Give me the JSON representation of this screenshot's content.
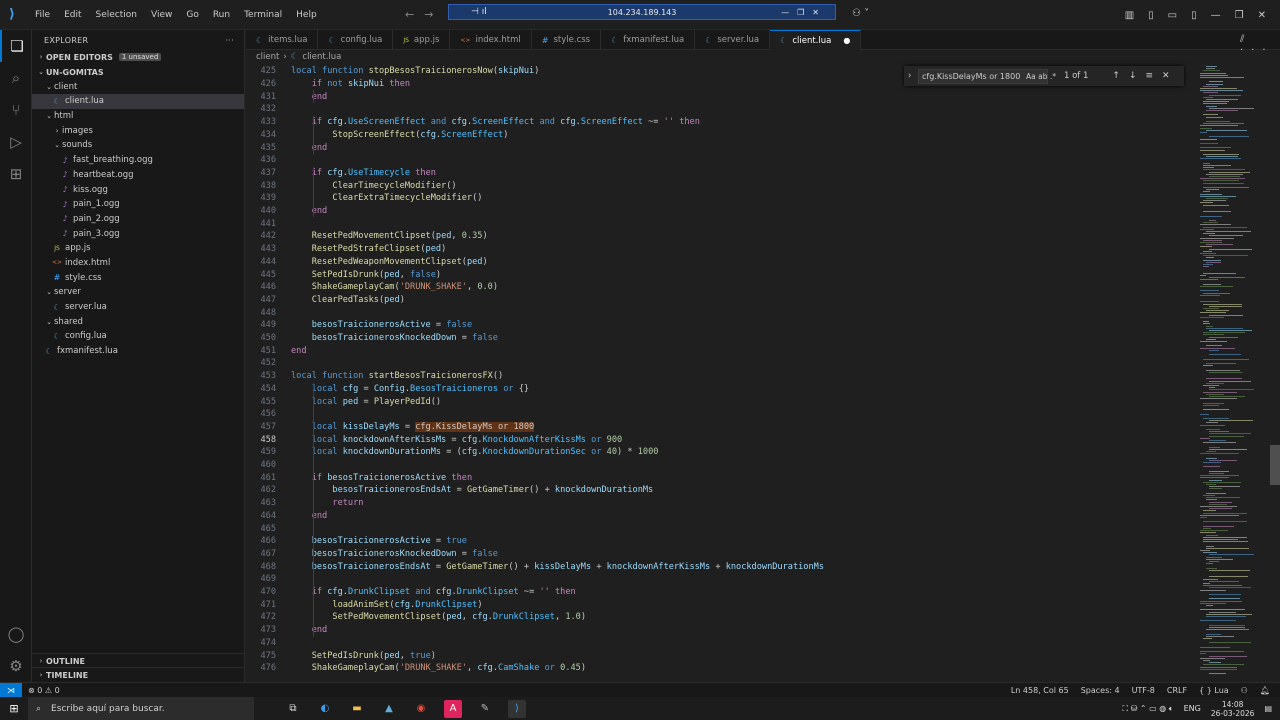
{
  "menu": [
    "File",
    "Edit",
    "Selection",
    "View",
    "Go",
    "Run",
    "Terminal",
    "Help"
  ],
  "remote_bar": {
    "address": "104.234.189.143"
  },
  "explorer": {
    "title": "EXPLORER",
    "open_editors": "OPEN EDITORS",
    "unsaved": "1 unsaved",
    "root": "UN-GOMITAS",
    "tree": [
      {
        "label": "client",
        "type": "folder",
        "depth": 1
      },
      {
        "label": "client.lua",
        "type": "lua",
        "depth": 2,
        "selected": true
      },
      {
        "label": "html",
        "type": "folder",
        "depth": 1
      },
      {
        "label": "images",
        "type": "folder-closed",
        "depth": 2
      },
      {
        "label": "sounds",
        "type": "folder",
        "depth": 2
      },
      {
        "label": "fast_breathing.ogg",
        "type": "ogg",
        "depth": 3
      },
      {
        "label": "heartbeat.ogg",
        "type": "ogg",
        "depth": 3
      },
      {
        "label": "kiss.ogg",
        "type": "ogg",
        "depth": 3
      },
      {
        "label": "pain_1.ogg",
        "type": "ogg",
        "depth": 3
      },
      {
        "label": "pain_2.ogg",
        "type": "ogg",
        "depth": 3
      },
      {
        "label": "pain_3.ogg",
        "type": "ogg",
        "depth": 3
      },
      {
        "label": "app.js",
        "type": "js",
        "depth": 2
      },
      {
        "label": "index.html",
        "type": "html",
        "depth": 2
      },
      {
        "label": "style.css",
        "type": "css",
        "depth": 2
      },
      {
        "label": "server",
        "type": "folder",
        "depth": 1
      },
      {
        "label": "server.lua",
        "type": "lua",
        "depth": 2
      },
      {
        "label": "shared",
        "type": "folder",
        "depth": 1
      },
      {
        "label": "config.lua",
        "type": "lua",
        "depth": 2
      },
      {
        "label": "fxmanifest.lua",
        "type": "lua",
        "depth": 1
      }
    ],
    "outline": "OUTLINE",
    "timeline": "TIMELINE"
  },
  "tabs": [
    {
      "label": "items.lua",
      "type": "lua"
    },
    {
      "label": "config.lua",
      "type": "lua"
    },
    {
      "label": "app.js",
      "type": "js"
    },
    {
      "label": "index.html",
      "type": "html"
    },
    {
      "label": "style.css",
      "type": "css"
    },
    {
      "label": "fxmanifest.lua",
      "type": "lua"
    },
    {
      "label": "server.lua",
      "type": "lua"
    },
    {
      "label": "client.lua",
      "type": "lua",
      "active": true
    }
  ],
  "breadcrumb": [
    "client",
    "client.lua"
  ],
  "find": {
    "query": "cfg.KissDelayMs or 1800",
    "options": "Aa  ab  .*",
    "count": "1 of 1"
  },
  "code_lines": [
    {
      "n": "425",
      "t": [
        [
          "kw",
          "local "
        ],
        [
          "kw",
          "function "
        ],
        [
          "fn",
          "stopBesosTraicionerosNow"
        ],
        [
          "code",
          "("
        ],
        [
          "vr",
          "skipNui"
        ],
        [
          "code",
          ")"
        ]
      ]
    },
    {
      "n": "426",
      "t": [
        [
          "code",
          "    "
        ],
        [
          "ctl",
          "if "
        ],
        [
          "kw",
          "not "
        ],
        [
          "vr",
          "skipNui "
        ],
        [
          "ctl",
          "then"
        ]
      ]
    },
    {
      "n": "431",
      "t": [
        [
          "code",
          "    "
        ],
        [
          "ctl",
          "end"
        ]
      ]
    },
    {
      "n": "432",
      "t": []
    },
    {
      "n": "433",
      "t": [
        [
          "code",
          "    "
        ],
        [
          "ctl",
          "if "
        ],
        [
          "vr",
          "cfg"
        ],
        [
          "code",
          "."
        ],
        [
          "prop",
          "UseScreenEffect "
        ],
        [
          "kw",
          "and "
        ],
        [
          "vr",
          "cfg"
        ],
        [
          "code",
          "."
        ],
        [
          "prop",
          "ScreenEffect "
        ],
        [
          "kw",
          "and "
        ],
        [
          "vr",
          "cfg"
        ],
        [
          "code",
          "."
        ],
        [
          "prop",
          "ScreenEffect "
        ],
        [
          "code",
          "~= "
        ],
        [
          "str",
          "'' "
        ],
        [
          "ctl",
          "then"
        ]
      ]
    },
    {
      "n": "434",
      "t": [
        [
          "code",
          "        "
        ],
        [
          "fn",
          "StopScreenEffect"
        ],
        [
          "code",
          "("
        ],
        [
          "vr",
          "cfg"
        ],
        [
          "code",
          "."
        ],
        [
          "prop",
          "ScreenEffect"
        ],
        [
          "code",
          ")"
        ]
      ]
    },
    {
      "n": "435",
      "t": [
        [
          "code",
          "    "
        ],
        [
          "ctl",
          "end"
        ]
      ]
    },
    {
      "n": "436",
      "t": []
    },
    {
      "n": "437",
      "t": [
        [
          "code",
          "    "
        ],
        [
          "ctl",
          "if "
        ],
        [
          "vr",
          "cfg"
        ],
        [
          "code",
          "."
        ],
        [
          "prop",
          "UseTimecycle "
        ],
        [
          "ctl",
          "then"
        ]
      ]
    },
    {
      "n": "438",
      "t": [
        [
          "code",
          "        "
        ],
        [
          "fn",
          "ClearTimecycleModifier"
        ],
        [
          "code",
          "()"
        ]
      ]
    },
    {
      "n": "439",
      "t": [
        [
          "code",
          "        "
        ],
        [
          "fn",
          "ClearExtraTimecycleModifier"
        ],
        [
          "code",
          "()"
        ]
      ]
    },
    {
      "n": "440",
      "t": [
        [
          "code",
          "    "
        ],
        [
          "ctl",
          "end"
        ]
      ]
    },
    {
      "n": "441",
      "t": []
    },
    {
      "n": "442",
      "t": [
        [
          "code",
          "    "
        ],
        [
          "fn",
          "ResetPedMovementClipset"
        ],
        [
          "code",
          "("
        ],
        [
          "vr",
          "ped"
        ],
        [
          "code",
          ", "
        ],
        [
          "num",
          "0.35"
        ],
        [
          "code",
          ")"
        ]
      ]
    },
    {
      "n": "443",
      "t": [
        [
          "code",
          "    "
        ],
        [
          "fn",
          "ResetPedStrafeClipset"
        ],
        [
          "code",
          "("
        ],
        [
          "vr",
          "ped"
        ],
        [
          "code",
          ")"
        ]
      ]
    },
    {
      "n": "444",
      "t": [
        [
          "code",
          "    "
        ],
        [
          "fn",
          "ResetPedWeaponMovementClipset"
        ],
        [
          "code",
          "("
        ],
        [
          "vr",
          "ped"
        ],
        [
          "code",
          ")"
        ]
      ]
    },
    {
      "n": "445",
      "t": [
        [
          "code",
          "    "
        ],
        [
          "fn",
          "SetPedIsDrunk"
        ],
        [
          "code",
          "("
        ],
        [
          "vr",
          "ped"
        ],
        [
          "code",
          ", "
        ],
        [
          "kw",
          "false"
        ],
        [
          "code",
          ")"
        ]
      ]
    },
    {
      "n": "446",
      "t": [
        [
          "code",
          "    "
        ],
        [
          "fn",
          "ShakeGameplayCam"
        ],
        [
          "code",
          "("
        ],
        [
          "str",
          "'DRUNK_SHAKE'"
        ],
        [
          "code",
          ", "
        ],
        [
          "num",
          "0.0"
        ],
        [
          "code",
          ")"
        ]
      ]
    },
    {
      "n": "447",
      "t": [
        [
          "code",
          "    "
        ],
        [
          "fn",
          "ClearPedTasks"
        ],
        [
          "code",
          "("
        ],
        [
          "vr",
          "ped"
        ],
        [
          "code",
          ")"
        ]
      ]
    },
    {
      "n": "448",
      "t": []
    },
    {
      "n": "449",
      "t": [
        [
          "code",
          "    "
        ],
        [
          "vr",
          "besosTraicionerosActive "
        ],
        [
          "code",
          "= "
        ],
        [
          "kw",
          "false"
        ]
      ]
    },
    {
      "n": "450",
      "t": [
        [
          "code",
          "    "
        ],
        [
          "vr",
          "besosTraicionerosKnockedDown "
        ],
        [
          "code",
          "= "
        ],
        [
          "kw",
          "false"
        ]
      ]
    },
    {
      "n": "451",
      "t": [
        [
          "ctl",
          "end"
        ]
      ]
    },
    {
      "n": "452",
      "t": []
    },
    {
      "n": "453",
      "t": [
        [
          "kw",
          "local "
        ],
        [
          "kw",
          "function "
        ],
        [
          "fn",
          "startBesosTraicionerosFX"
        ],
        [
          "code",
          "()"
        ]
      ]
    },
    {
      "n": "454",
      "t": [
        [
          "code",
          "    "
        ],
        [
          "kw",
          "local "
        ],
        [
          "vr",
          "cfg "
        ],
        [
          "code",
          "= "
        ],
        [
          "vr",
          "Config"
        ],
        [
          "code",
          "."
        ],
        [
          "prop",
          "BesosTraicioneros "
        ],
        [
          "kw",
          "or "
        ],
        [
          "code",
          "{}"
        ]
      ]
    },
    {
      "n": "455",
      "t": [
        [
          "code",
          "    "
        ],
        [
          "kw",
          "local "
        ],
        [
          "vr",
          "ped "
        ],
        [
          "code",
          "= "
        ],
        [
          "fn",
          "PlayerPedId"
        ],
        [
          "code",
          "()"
        ]
      ]
    },
    {
      "n": "456",
      "t": []
    },
    {
      "n": "457",
      "t": [
        [
          "code",
          "    "
        ],
        [
          "kw",
          "local "
        ],
        [
          "vr",
          "kissDelayMs "
        ],
        [
          "code",
          "= "
        ],
        [
          "hl",
          "cfg.KissDelayMs or 1800"
        ]
      ]
    },
    {
      "n": "458",
      "t": [
        [
          "code",
          "    "
        ],
        [
          "kw",
          "local "
        ],
        [
          "vr",
          "knockdownAfterKissMs "
        ],
        [
          "code",
          "= "
        ],
        [
          "vr",
          "cfg"
        ],
        [
          "code",
          "."
        ],
        [
          "prop",
          "KnockdownAfterKissMs "
        ],
        [
          "kw",
          "or "
        ],
        [
          "num",
          "900"
        ]
      ]
    },
    {
      "n": "459",
      "t": [
        [
          "code",
          "    "
        ],
        [
          "kw",
          "local "
        ],
        [
          "vr",
          "knockdownDurationMs "
        ],
        [
          "code",
          "= ("
        ],
        [
          "vr",
          "cfg"
        ],
        [
          "code",
          "."
        ],
        [
          "prop",
          "KnockdownDurationSec "
        ],
        [
          "kw",
          "or "
        ],
        [
          "num",
          "40"
        ],
        [
          "code",
          ") * "
        ],
        [
          "num",
          "1000"
        ]
      ]
    },
    {
      "n": "460",
      "t": []
    },
    {
      "n": "461",
      "t": [
        [
          "code",
          "    "
        ],
        [
          "ctl",
          "if "
        ],
        [
          "vr",
          "besosTraicionerosActive "
        ],
        [
          "ctl",
          "then"
        ]
      ]
    },
    {
      "n": "462",
      "t": [
        [
          "code",
          "        "
        ],
        [
          "vr",
          "besosTraicionerosEndsAt "
        ],
        [
          "code",
          "= "
        ],
        [
          "fn",
          "GetGameTimer"
        ],
        [
          "code",
          "() + "
        ],
        [
          "vr",
          "knockdownDurationMs"
        ]
      ]
    },
    {
      "n": "463",
      "t": [
        [
          "code",
          "        "
        ],
        [
          "ctl",
          "return"
        ]
      ]
    },
    {
      "n": "464",
      "t": [
        [
          "code",
          "    "
        ],
        [
          "ctl",
          "end"
        ]
      ]
    },
    {
      "n": "465",
      "t": []
    },
    {
      "n": "466",
      "t": [
        [
          "code",
          "    "
        ],
        [
          "vr",
          "besosTraicionerosActive "
        ],
        [
          "code",
          "= "
        ],
        [
          "kw",
          "true"
        ]
      ]
    },
    {
      "n": "467",
      "t": [
        [
          "code",
          "    "
        ],
        [
          "vr",
          "besosTraicionerosKnockedDown "
        ],
        [
          "code",
          "= "
        ],
        [
          "kw",
          "false"
        ]
      ]
    },
    {
      "n": "468",
      "t": [
        [
          "code",
          "    "
        ],
        [
          "vr",
          "besosTraicionerosEndsAt "
        ],
        [
          "code",
          "= "
        ],
        [
          "fn",
          "GetGameTimer"
        ],
        [
          "code",
          "() + "
        ],
        [
          "vr",
          "kissDelayMs "
        ],
        [
          "code",
          "+ "
        ],
        [
          "vr",
          "knockdownAfterKissMs "
        ],
        [
          "code",
          "+ "
        ],
        [
          "vr",
          "knockdownDurationMs"
        ]
      ]
    },
    {
      "n": "469",
      "t": []
    },
    {
      "n": "470",
      "t": [
        [
          "code",
          "    "
        ],
        [
          "ctl",
          "if "
        ],
        [
          "vr",
          "cfg"
        ],
        [
          "code",
          "."
        ],
        [
          "prop",
          "DrunkClipset "
        ],
        [
          "kw",
          "and "
        ],
        [
          "vr",
          "cfg"
        ],
        [
          "code",
          "."
        ],
        [
          "prop",
          "DrunkClipset "
        ],
        [
          "code",
          "~= "
        ],
        [
          "str",
          "'' "
        ],
        [
          "ctl",
          "then"
        ]
      ]
    },
    {
      "n": "471",
      "t": [
        [
          "code",
          "        "
        ],
        [
          "fn",
          "loadAnimSet"
        ],
        [
          "code",
          "("
        ],
        [
          "vr",
          "cfg"
        ],
        [
          "code",
          "."
        ],
        [
          "prop",
          "DrunkClipset"
        ],
        [
          "code",
          ")"
        ]
      ]
    },
    {
      "n": "472",
      "t": [
        [
          "code",
          "        "
        ],
        [
          "fn",
          "SetPedMovementClipset"
        ],
        [
          "code",
          "("
        ],
        [
          "vr",
          "ped"
        ],
        [
          "code",
          ", "
        ],
        [
          "vr",
          "cfg"
        ],
        [
          "code",
          "."
        ],
        [
          "prop",
          "DrunkClipset"
        ],
        [
          "code",
          ", "
        ],
        [
          "num",
          "1.0"
        ],
        [
          "code",
          ")"
        ]
      ]
    },
    {
      "n": "473",
      "t": [
        [
          "code",
          "    "
        ],
        [
          "ctl",
          "end"
        ]
      ]
    },
    {
      "n": "474",
      "t": []
    },
    {
      "n": "475",
      "t": [
        [
          "code",
          "    "
        ],
        [
          "fn",
          "SetPedIsDrunk"
        ],
        [
          "code",
          "("
        ],
        [
          "vr",
          "ped"
        ],
        [
          "code",
          ", "
        ],
        [
          "kw",
          "true"
        ],
        [
          "code",
          ")"
        ]
      ]
    },
    {
      "n": "476",
      "t": [
        [
          "code",
          "    "
        ],
        [
          "fn",
          "ShakeGameplayCam"
        ],
        [
          "code",
          "("
        ],
        [
          "str",
          "'DRUNK_SHAKE'"
        ],
        [
          "code",
          ", "
        ],
        [
          "vr",
          "cfg"
        ],
        [
          "code",
          "."
        ],
        [
          "prop",
          "CamShake "
        ],
        [
          "kw",
          "or "
        ],
        [
          "num",
          "0.45"
        ],
        [
          "code",
          ")"
        ]
      ]
    }
  ],
  "current_line": "458",
  "status": {
    "errors": "0",
    "warnings": "0",
    "position": "Ln 458, Col 65",
    "spaces": "Spaces: 4",
    "encoding": "UTF-8",
    "eol": "CRLF",
    "language": "Lua"
  },
  "taskbar": {
    "search_placeholder": "Escribe aquí para buscar.",
    "lang": "ENG",
    "time": "14:08",
    "date": "26-03-2026"
  }
}
